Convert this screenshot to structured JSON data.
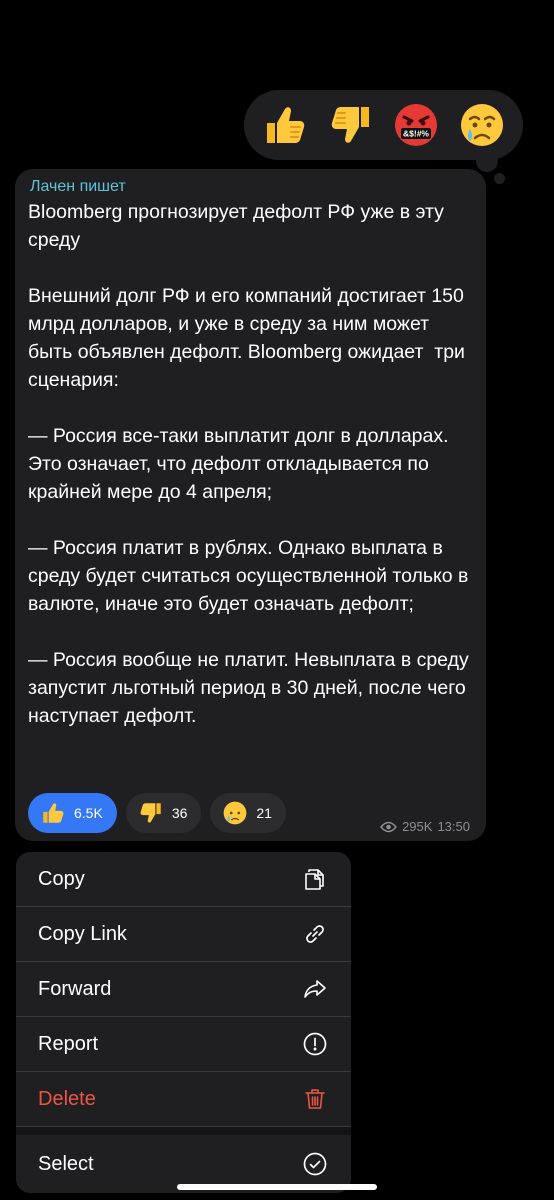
{
  "reaction_picker": {
    "items": [
      "thumbs-up-emoji",
      "thumbs-down-emoji",
      "swearing-face-emoji",
      "crying-face-emoji"
    ],
    "swear_text": "&$!#%"
  },
  "message": {
    "author": "Лачен пишет",
    "text": "Bloomberg прогнозирует дефолт РФ уже в эту среду\n\nВнешний долг РФ и его компаний достигает 150 млрд долларов, и уже в среду за ним может быть объявлен дефолт. Bloomberg ожидает  три сценария:\n\n— Россия все-таки выплатит долг в долларах. Это означает, что дефолт откладывается по крайней мере до 4 апреля;\n\n— Россия платит в рублях. Однако выплата в среду будет считаться осуществленной только в валюте, иначе это будет означать дефолт;\n\n— Россия вообще не платит. Невыплата в среду запустит льготный период в 30 дней, после чего наступает дефолт.",
    "reactions": [
      {
        "emoji": "thumbs-up-emoji",
        "count": "6.5K",
        "active": true
      },
      {
        "emoji": "thumbs-down-emoji",
        "count": "36",
        "active": false
      },
      {
        "emoji": "crying-face-emoji",
        "count": "21",
        "active": false
      }
    ],
    "views": "295K",
    "time": "13:50"
  },
  "menu": {
    "items": [
      {
        "label": "Copy",
        "icon": "copy-icon"
      },
      {
        "label": "Copy Link",
        "icon": "link-icon"
      },
      {
        "label": "Forward",
        "icon": "forward-icon"
      },
      {
        "label": "Report",
        "icon": "report-icon"
      },
      {
        "label": "Delete",
        "icon": "trash-icon",
        "color": "#eb5545"
      }
    ],
    "select": {
      "label": "Select",
      "icon": "checkmark-circle-icon"
    }
  },
  "colors": {
    "accent": "#3478f6",
    "author": "#5fc2d9",
    "danger": "#eb5545",
    "bubble": "#1f1f21"
  }
}
